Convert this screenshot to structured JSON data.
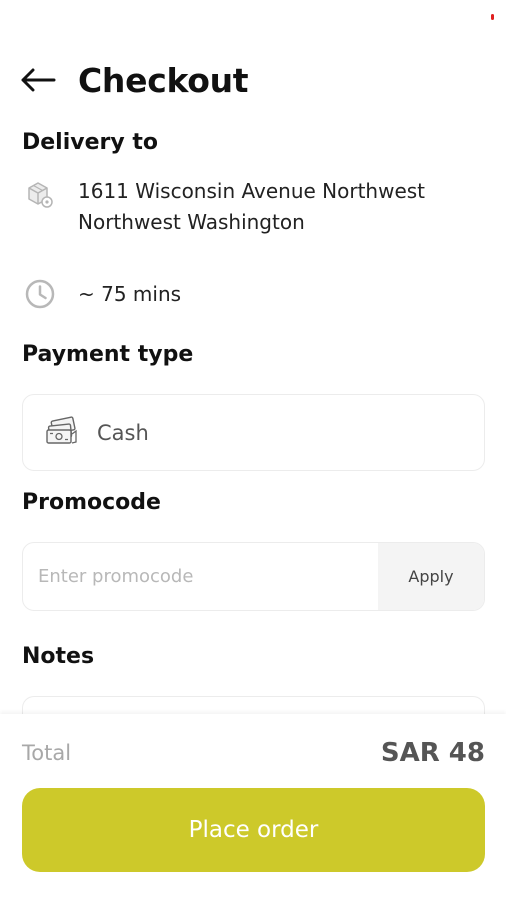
{
  "header": {
    "title": "Checkout",
    "back_icon": "arrow-left-icon"
  },
  "delivery": {
    "section_title": "Delivery to",
    "address_line1": "1611 Wisconsin Avenue Northwest",
    "address_line2": "Northwest Washington",
    "address_icon": "package-location-icon",
    "eta": "~ 75 mins",
    "eta_icon": "clock-icon"
  },
  "payment": {
    "section_title": "Payment type",
    "method": "Cash",
    "method_icon": "cash-icon"
  },
  "promo": {
    "section_title": "Promocode",
    "placeholder": "Enter promocode",
    "value": "",
    "apply_label": "Apply"
  },
  "notes": {
    "section_title": "Notes"
  },
  "summary": {
    "total_label": "Total",
    "total_value": "SAR 48"
  },
  "actions": {
    "place_order_label": "Place order"
  },
  "colors": {
    "accent": "#cdc92a",
    "status_dot": "#e02020"
  }
}
